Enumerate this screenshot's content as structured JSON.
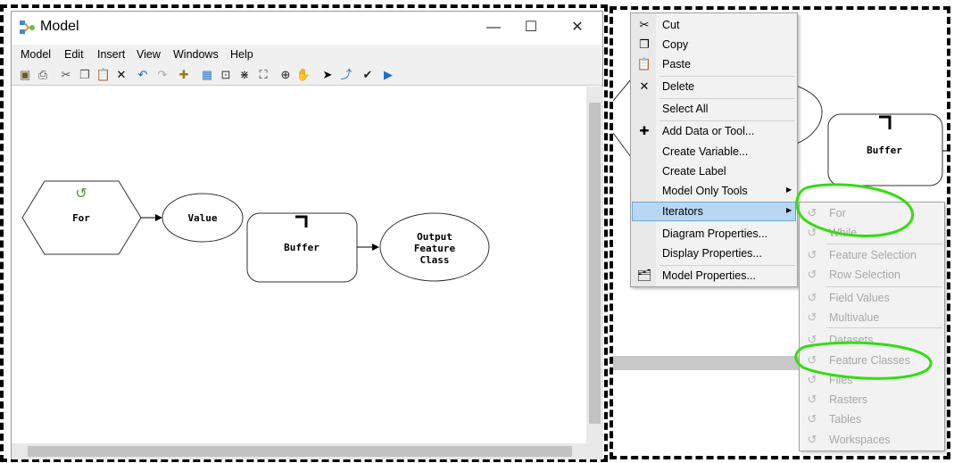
{
  "window": {
    "title": "Model",
    "minimize": "—",
    "maximize": "☐",
    "close": "✕"
  },
  "menubar": [
    "Model",
    "Edit",
    "Insert",
    "View",
    "Windows",
    "Help"
  ],
  "toolbar": [
    {
      "icon": "save-icon",
      "g": "▣",
      "c": "#6b5a2a"
    },
    {
      "icon": "print-icon",
      "g": "⎙",
      "c": "#444"
    },
    {
      "icon": "cut-icon",
      "g": "✂",
      "c": "#555"
    },
    {
      "icon": "copy-icon",
      "g": "❐",
      "c": "#555"
    },
    {
      "icon": "paste-icon",
      "g": "📋",
      "c": "#8a6a30"
    },
    {
      "icon": "delete-icon",
      "g": "✕",
      "c": "#000"
    },
    {
      "icon": "undo-icon",
      "g": "↶",
      "c": "#1c5fbf"
    },
    {
      "icon": "redo-icon",
      "g": "↷",
      "c": "#aaa"
    },
    {
      "icon": "add-data-icon",
      "g": "✚",
      "c": "#a07a10"
    },
    {
      "icon": "auto-layout-icon",
      "g": "▦",
      "c": "#2d7fd0"
    },
    {
      "icon": "full-extent-icon",
      "g": "⊡",
      "c": "#333"
    },
    {
      "icon": "fixed-zoom-in-icon",
      "g": "⋇",
      "c": "#222"
    },
    {
      "icon": "fixed-zoom-out-icon",
      "g": "⛶",
      "c": "#222"
    },
    {
      "icon": "zoom-in-icon",
      "g": "⊕",
      "c": "#222"
    },
    {
      "icon": "pan-icon",
      "g": "✋",
      "c": "#444"
    },
    {
      "icon": "select-icon",
      "g": "➤",
      "c": "#000"
    },
    {
      "icon": "connect-icon",
      "g": "⤴",
      "c": "#2d6fd0"
    },
    {
      "icon": "validate-icon",
      "g": "✔",
      "c": "#222"
    },
    {
      "icon": "run-icon",
      "g": "▶",
      "c": "#1c6fd0"
    }
  ],
  "diagram": {
    "for": "For",
    "value": "Value",
    "buffer": "Buffer",
    "output": [
      "Output",
      "Feature",
      "Class"
    ]
  },
  "context_menu": [
    {
      "label": "Cut",
      "icon": "cut-icon",
      "g": "✂"
    },
    {
      "label": "Copy",
      "icon": "copy-icon",
      "g": "❐"
    },
    {
      "label": "Paste",
      "icon": "paste-icon",
      "g": "📋"
    },
    {
      "label": "Delete",
      "icon": "delete-icon",
      "g": "✕"
    },
    {
      "label": "Select All"
    },
    {
      "label": "Add Data or Tool...",
      "icon": "add-data-icon",
      "g": "✚"
    },
    {
      "label": "Create Variable..."
    },
    {
      "label": "Create Label"
    },
    {
      "label": "Model Only Tools",
      "submenu": true
    },
    {
      "label": "Iterators",
      "submenu": true,
      "highlighted": true
    },
    {
      "label": "Diagram Properties..."
    },
    {
      "label": "Display Properties..."
    },
    {
      "label": "Model Properties...",
      "icon": "model-properties-icon",
      "g": "🗂"
    }
  ],
  "iterators_menu": [
    "For",
    "While",
    "Feature Selection",
    "Row Selection",
    "Field Values",
    "Multivalue",
    "Datasets",
    "Feature Classes",
    "Files",
    "Rasters",
    "Tables",
    "Workspaces"
  ],
  "right_diagram": {
    "buffer": "Buffer"
  },
  "colors": {
    "highlight": "#b9d7f3",
    "annotation": "#33dd11"
  }
}
